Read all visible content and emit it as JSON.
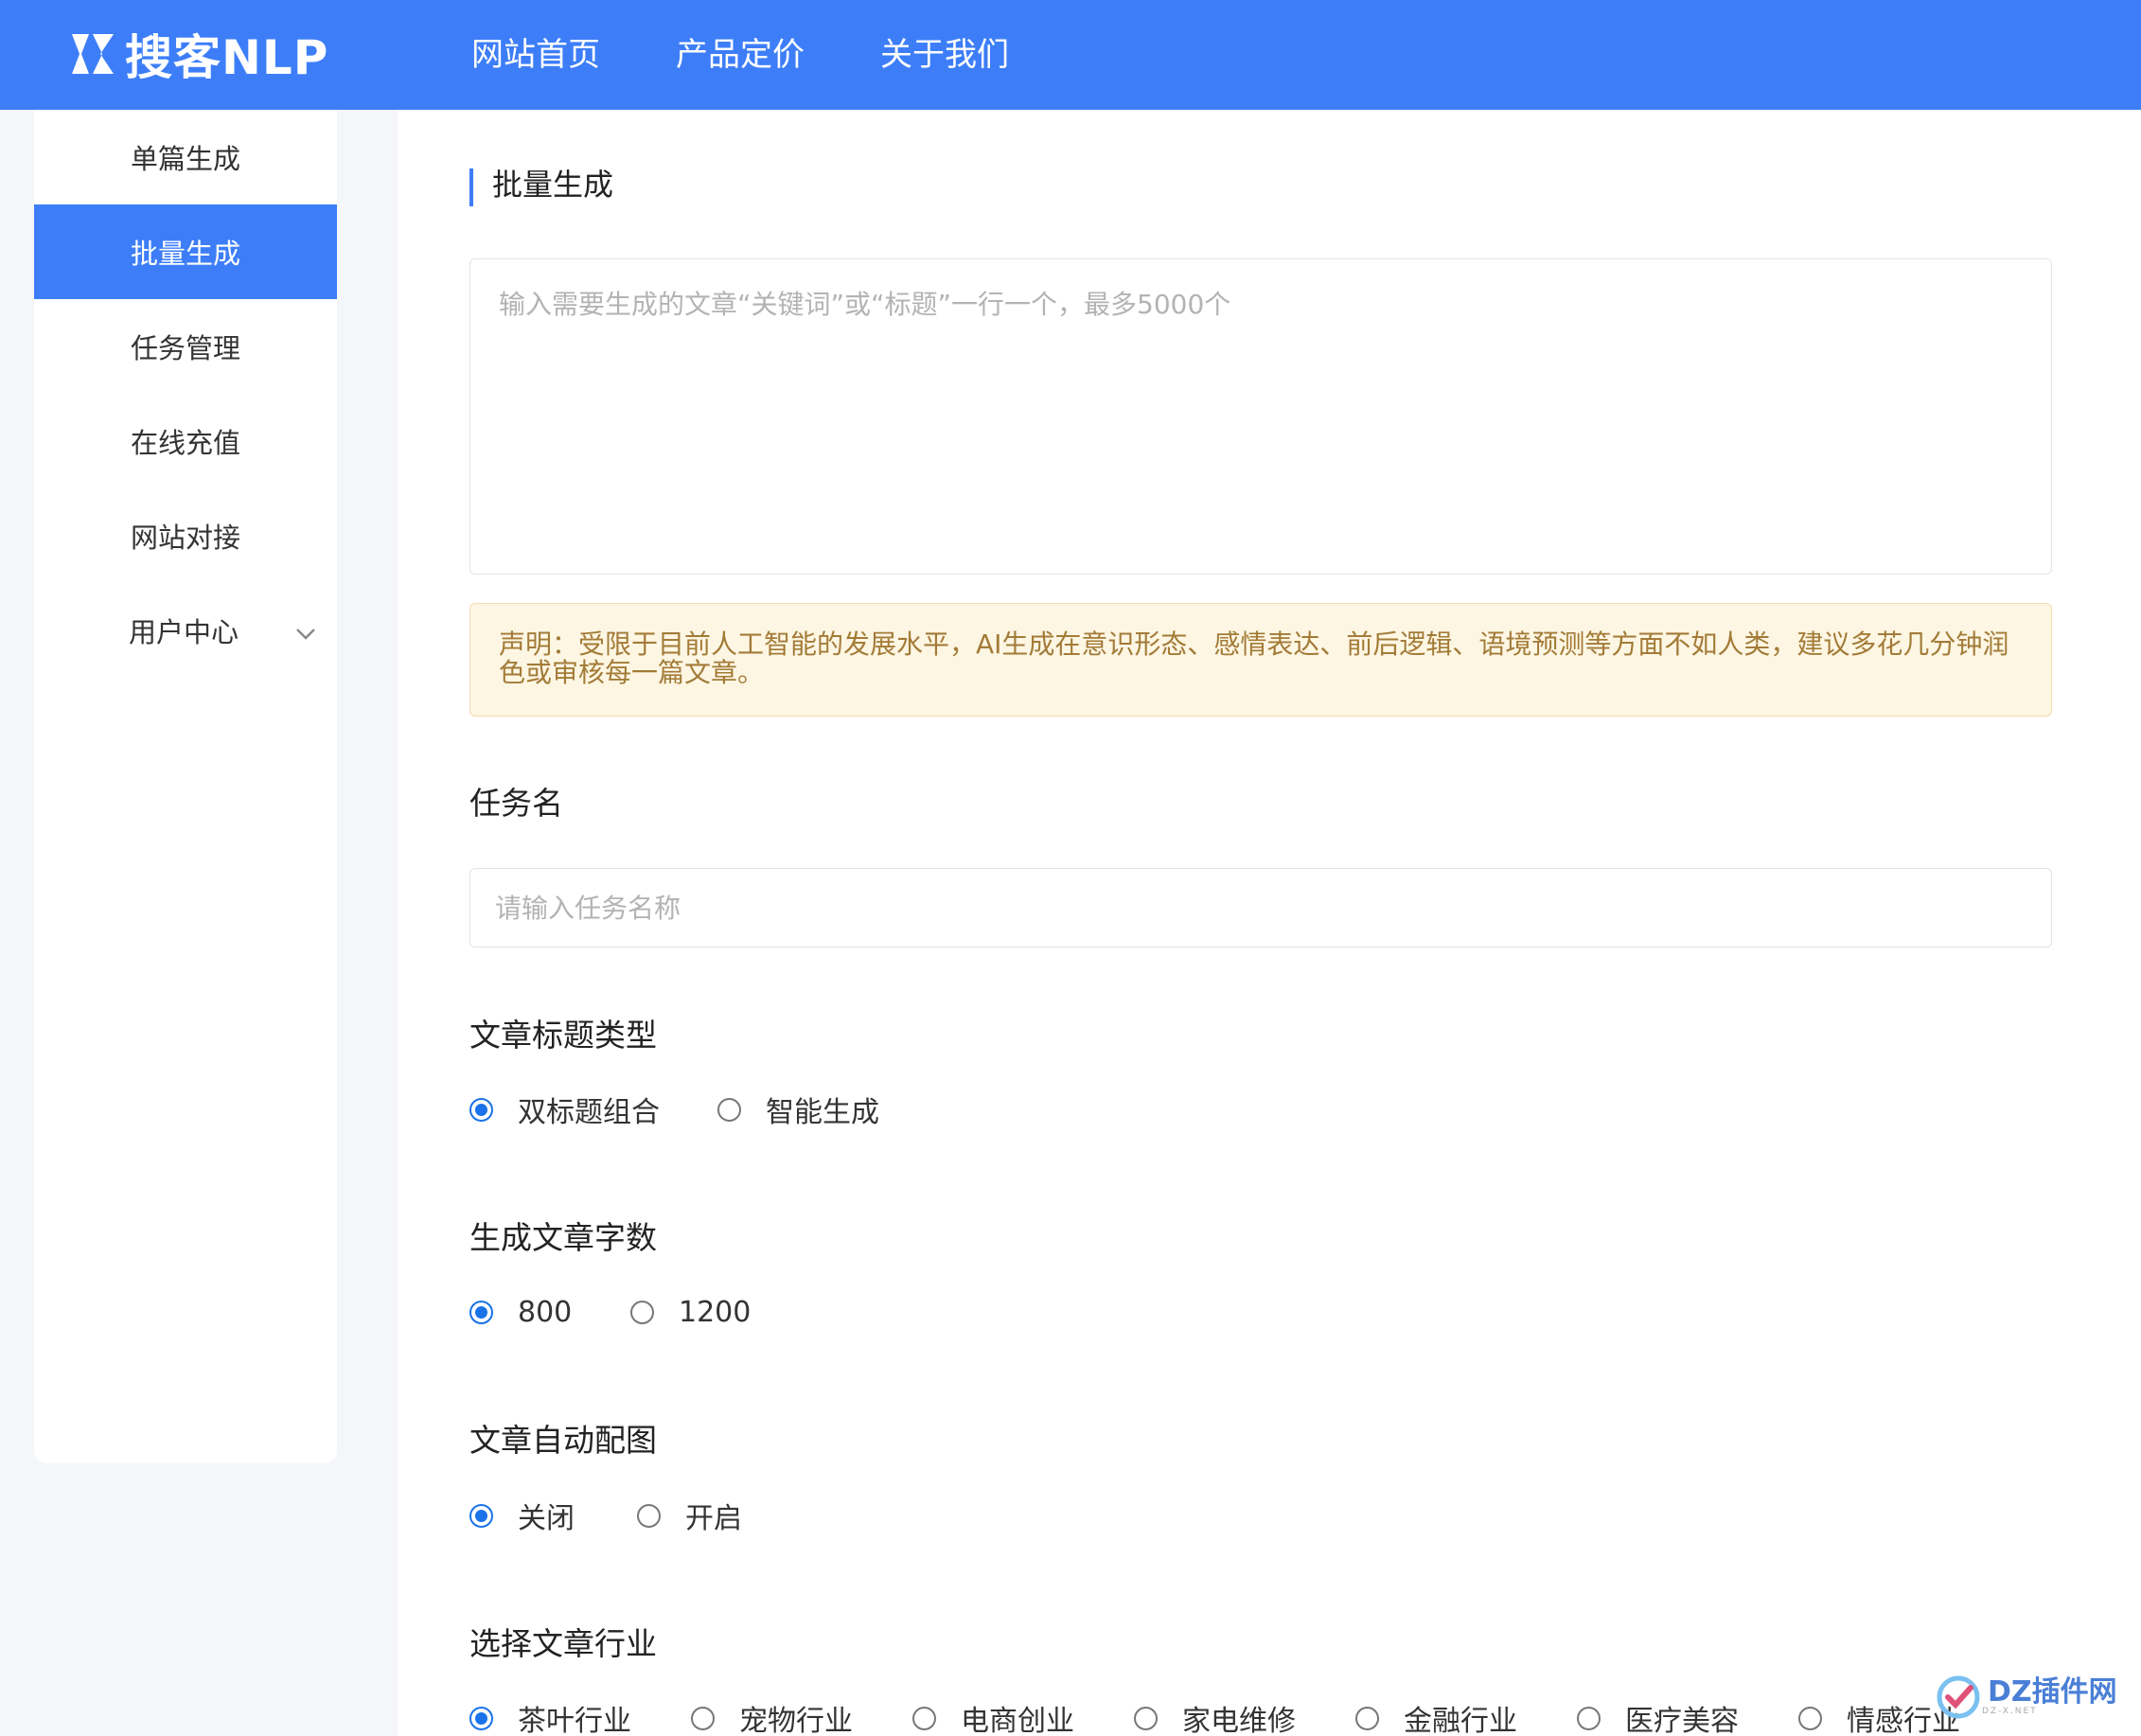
{
  "header": {
    "logo_text": "搜客NLP",
    "nav": [
      "网站首页",
      "产品定价",
      "关于我们"
    ]
  },
  "sidebar": {
    "items": [
      {
        "label": "单篇生成"
      },
      {
        "label": "批量生成",
        "active": true
      },
      {
        "label": "任务管理"
      },
      {
        "label": "在线充值"
      },
      {
        "label": "网站对接"
      },
      {
        "label": "用户中心",
        "expandable": true
      }
    ]
  },
  "main": {
    "section_title": "批量生成",
    "keywords_placeholder": "输入需要生成的文章“关键词”或“标题”一行一个，最多5000个",
    "notice": "声明：受限于目前人工智能的发展水平，AI生成在意识形态、感情表达、前后逻辑、语境预测等方面不如人类，建议多花几分钟润色或审核每一篇文章。",
    "task_name_label": "任务名",
    "task_name_placeholder": "请输入任务名称",
    "title_type": {
      "label": "文章标题类型",
      "options": [
        "双标题组合",
        "智能生成"
      ],
      "selected": "双标题组合"
    },
    "word_count": {
      "label": "生成文章字数",
      "options": [
        "800",
        "1200"
      ],
      "selected": "800"
    },
    "auto_image": {
      "label": "文章自动配图",
      "options": [
        "关闭",
        "开启"
      ],
      "selected": "关闭"
    },
    "industry": {
      "label": "选择文章行业",
      "options": [
        "茶叶行业",
        "宠物行业",
        "电商创业",
        "家电维修",
        "金融行业",
        "医疗美容",
        "情感行业"
      ],
      "selected": "茶叶行业"
    }
  },
  "watermark": {
    "text": "DZ插件网",
    "sub": "DZ-X.NET"
  },
  "colors": {
    "primary": "#3d7ef8",
    "radio_checked": "#1a73e8",
    "notice_bg": "#fdf6e3",
    "notice_text": "#a37b37"
  }
}
